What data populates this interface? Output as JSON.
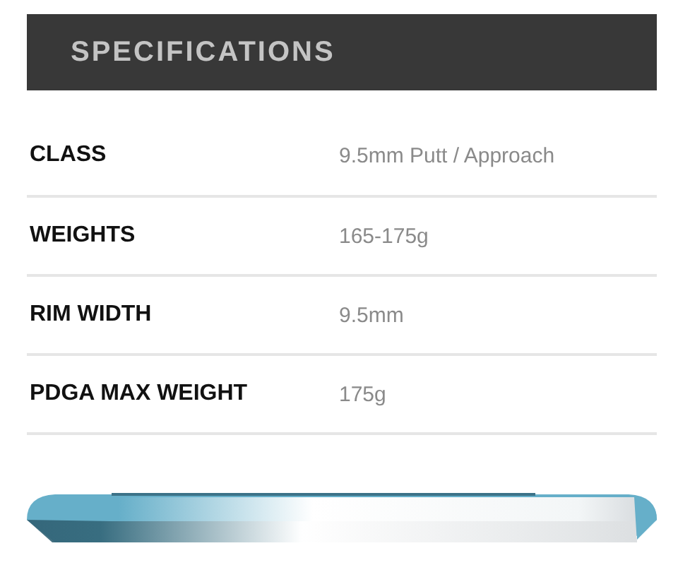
{
  "header": {
    "title": "SPECIFICATIONS"
  },
  "specs": [
    {
      "label": "CLASS",
      "value": "9.5mm Putt / Approach"
    },
    {
      "label": "WEIGHTS",
      "value": "165-175g"
    },
    {
      "label": "RIM WIDTH",
      "value": "9.5mm"
    },
    {
      "label": "PDGA MAX WEIGHT",
      "value": "175g"
    }
  ]
}
